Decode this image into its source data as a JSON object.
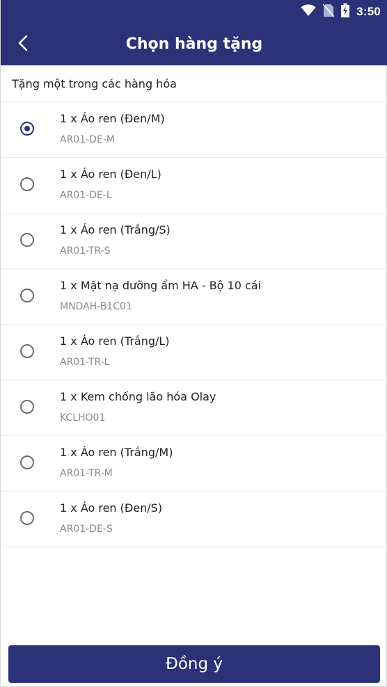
{
  "status_bar": {
    "time": "3:50",
    "icons": [
      "wifi-icon",
      "no-sim-icon",
      "battery-charging-icon"
    ]
  },
  "app_bar": {
    "title": "Chọn hàng tặng",
    "back_icon": "chevron-left-icon"
  },
  "section": {
    "header": "Tặng một trong các hàng hóa"
  },
  "gifts": [
    {
      "name": "1 x Áo ren (Đen/M)",
      "code": "AR01-DE-M",
      "selected": true
    },
    {
      "name": "1 x Áo ren (Đen/L)",
      "code": "AR01-DE-L",
      "selected": false
    },
    {
      "name": "1 x Áo ren (Trắng/S)",
      "code": "AR01-TR-S",
      "selected": false
    },
    {
      "name": "1 x Mặt nạ dưỡng ẩm HA - Bộ 10 cái",
      "code": "MNDAH-B1C01",
      "selected": false
    },
    {
      "name": "1 x Áo ren (Trắng/L)",
      "code": "AR01-TR-L",
      "selected": false
    },
    {
      "name": "1 x Kem chống lão hóa Olay",
      "code": "KCLHO01",
      "selected": false
    },
    {
      "name": "1 x Áo ren (Trắng/M)",
      "code": "AR01-TR-M",
      "selected": false
    },
    {
      "name": "1 x Áo ren (Đen/S)",
      "code": "AR01-DE-S",
      "selected": false
    }
  ],
  "footer": {
    "confirm_label": "Đồng ý"
  },
  "colors": {
    "primary": "#2b3278",
    "divider": "#ececec",
    "secondary_text": "#8a8a8a"
  }
}
